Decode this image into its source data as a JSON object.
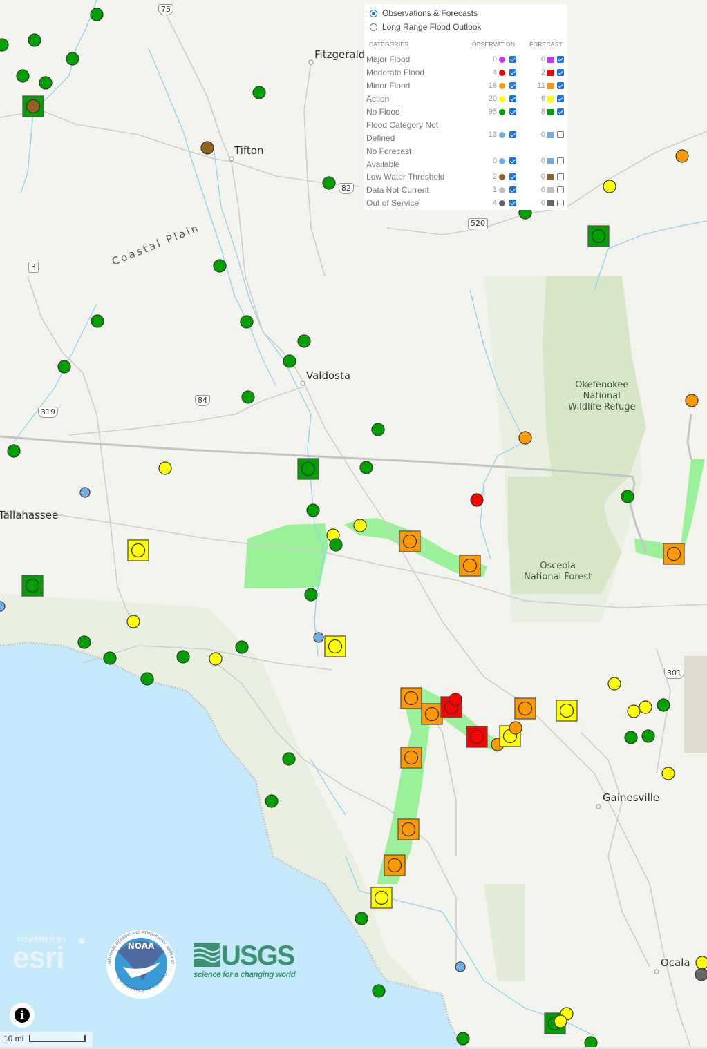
{
  "map": {
    "colors": {
      "land": "#f3f4ee",
      "water": "#c4e9fb",
      "forest": "#dbe8cf",
      "park": "#cfe0c0",
      "urban": "#e6e3da",
      "road": "#cdcdcd",
      "state_line": "#c4c4c4",
      "river": "#8fd3ea",
      "flood_zone": "#7df07d"
    },
    "places": [
      {
        "name": "Fitzgerald",
        "kind": "city"
      },
      {
        "name": "Tifton",
        "kind": "city"
      },
      {
        "name": "Valdosta",
        "kind": "city"
      },
      {
        "name": "Tallahassee",
        "kind": "city"
      },
      {
        "name": "Gainesville",
        "kind": "city"
      },
      {
        "name": "Ocala",
        "kind": "city"
      },
      {
        "name": "Coastal Plain",
        "kind": "region"
      },
      {
        "name": "Okefenokee\nNational\nWildlife Refuge",
        "kind": "park"
      },
      {
        "name": "Osceola\nNational Forest",
        "kind": "park"
      }
    ],
    "shields": [
      {
        "label": "75",
        "type": "interstate"
      },
      {
        "label": "82",
        "type": "us"
      },
      {
        "label": "3",
        "type": "state"
      },
      {
        "label": "520",
        "type": "state"
      },
      {
        "label": "84",
        "type": "us"
      },
      {
        "label": "319",
        "type": "us"
      },
      {
        "label": "301",
        "type": "us"
      }
    ]
  },
  "legend": {
    "modes": [
      {
        "label": "Observations & Forecasts",
        "selected": true
      },
      {
        "label": "Long Range Flood Outlook",
        "selected": false
      }
    ],
    "headers": {
      "categories": "CATEGORIES",
      "observation": "OBSERVATION",
      "forecast": "FORECAST"
    },
    "categories": [
      {
        "label": "Major Flood",
        "label2": "",
        "color": "#cc33ff",
        "obs_count": "0",
        "obs_checked": true,
        "fc_count": "0",
        "fc_checked": true
      },
      {
        "label": "Moderate Flood",
        "label2": "",
        "color": "#ff0000",
        "obs_count": "4",
        "obs_checked": true,
        "fc_count": "2",
        "fc_checked": true
      },
      {
        "label": "Minor Flood",
        "label2": "",
        "color": "#ff9900",
        "obs_count": "18",
        "obs_checked": true,
        "fc_count": "11",
        "fc_checked": true
      },
      {
        "label": "Action",
        "label2": "",
        "color": "#ffff00",
        "obs_count": "20",
        "obs_checked": true,
        "fc_count": "6",
        "fc_checked": true
      },
      {
        "label": "No Flood",
        "label2": "",
        "color": "#00a000",
        "obs_count": "95",
        "obs_checked": true,
        "fc_count": "8",
        "fc_checked": true
      },
      {
        "label": "Flood Category Not",
        "label2": "Defined",
        "color": "#72afe9",
        "obs_count": "13",
        "obs_checked": true,
        "fc_count": "0",
        "fc_checked": false
      },
      {
        "label": "No Forecast",
        "label2": "Available",
        "color": "#72afe9",
        "obs_count": "0",
        "obs_checked": true,
        "fc_count": "0",
        "fc_checked": false
      },
      {
        "label": "Low Water Threshold",
        "label2": "",
        "color": "#906320",
        "obs_count": "2",
        "obs_checked": true,
        "fc_count": "0",
        "fc_checked": false
      },
      {
        "label": "Data Not Current",
        "label2": "",
        "color": "#bdc2bb",
        "obs_count": "1",
        "obs_checked": true,
        "fc_count": "0",
        "fc_checked": false
      },
      {
        "label": "Out of Service",
        "label2": "",
        "color": "#666666",
        "obs_count": "4",
        "obs_checked": true,
        "fc_count": "0",
        "fc_checked": false
      }
    ]
  },
  "gauges": [
    {
      "obs": "No Flood",
      "fc": null
    },
    {
      "obs": "Low Water Threshold",
      "fc": "No Flood"
    },
    {
      "obs": "Low Water Threshold",
      "fc": null
    },
    {
      "obs": "No Flood",
      "fc": "No Flood"
    },
    {
      "obs": "Minor Flood",
      "fc": "Minor Flood"
    },
    {
      "obs": "Moderate Flood",
      "fc": "Moderate Flood"
    },
    {
      "obs": "Action",
      "fc": "Action"
    },
    {
      "obs": "Flood Category Not Defined",
      "fc": null
    },
    {
      "obs": "Out of Service",
      "fc": null
    }
  ],
  "attribution": {
    "esri_top": "POWERED BY",
    "esri_word": "esri",
    "noaa_word": "NOAA",
    "noaa_ring_top": "NATIONAL OCEANIC AND ATMOSPHERIC ADMINISTRATION",
    "noaa_ring_bottom": "U.S. DEPARTMENT OF COMMERCE",
    "usgs_word": "USGS",
    "usgs_tagline": "science for a changing world"
  },
  "controls": {
    "info_icon": "i",
    "scale_label": "10 mi"
  }
}
